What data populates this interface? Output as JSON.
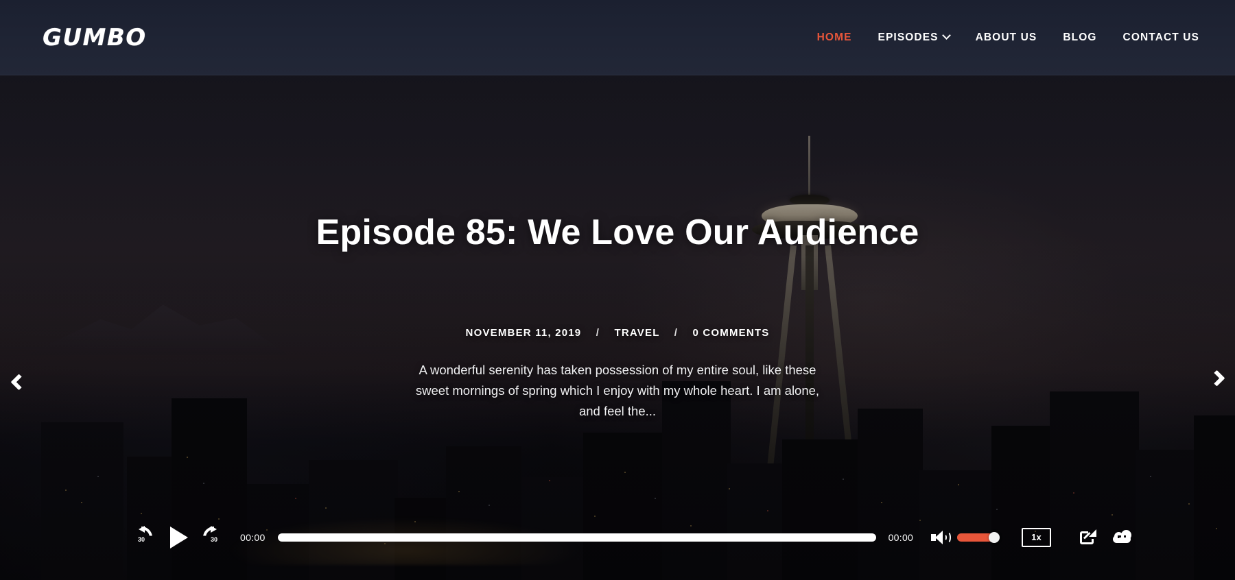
{
  "site": {
    "logo": "GUMBO",
    "accent_color": "#e8563a",
    "header_bg": "#1d2131"
  },
  "nav": {
    "items": [
      {
        "label": "HOME",
        "active": true,
        "has_caret": false
      },
      {
        "label": "EPISODES",
        "active": false,
        "has_caret": true
      },
      {
        "label": "ABOUT US",
        "active": false,
        "has_caret": false
      },
      {
        "label": "BLOG",
        "active": false,
        "has_caret": false
      },
      {
        "label": "CONTACT US",
        "active": false,
        "has_caret": false
      }
    ]
  },
  "hero": {
    "title": "Episode 85: We Love Our Audience",
    "meta": {
      "date": "NOVEMBER 11, 2019",
      "separator": "/",
      "category": "TRAVEL",
      "comments": "0 COMMENTS"
    },
    "description": "A wonderful serenity has taken possession of my entire soul, like these sweet mornings of spring which I enjoy with my whole heart. I am alone, and feel the...",
    "image_alt": "Night city skyline with Space Needle at dusk"
  },
  "carousel": {
    "prev_label": "Previous slide",
    "next_label": "Next slide"
  },
  "player": {
    "rewind_seconds": "30",
    "forward_seconds": "30",
    "play_label": "Play",
    "current_time": "00:00",
    "duration": "00:00",
    "progress_percent": 0,
    "volume_percent": 100,
    "volume_color": "#e8563a",
    "speed_label": "1x",
    "share_label": "Share",
    "download_label": "Download"
  }
}
